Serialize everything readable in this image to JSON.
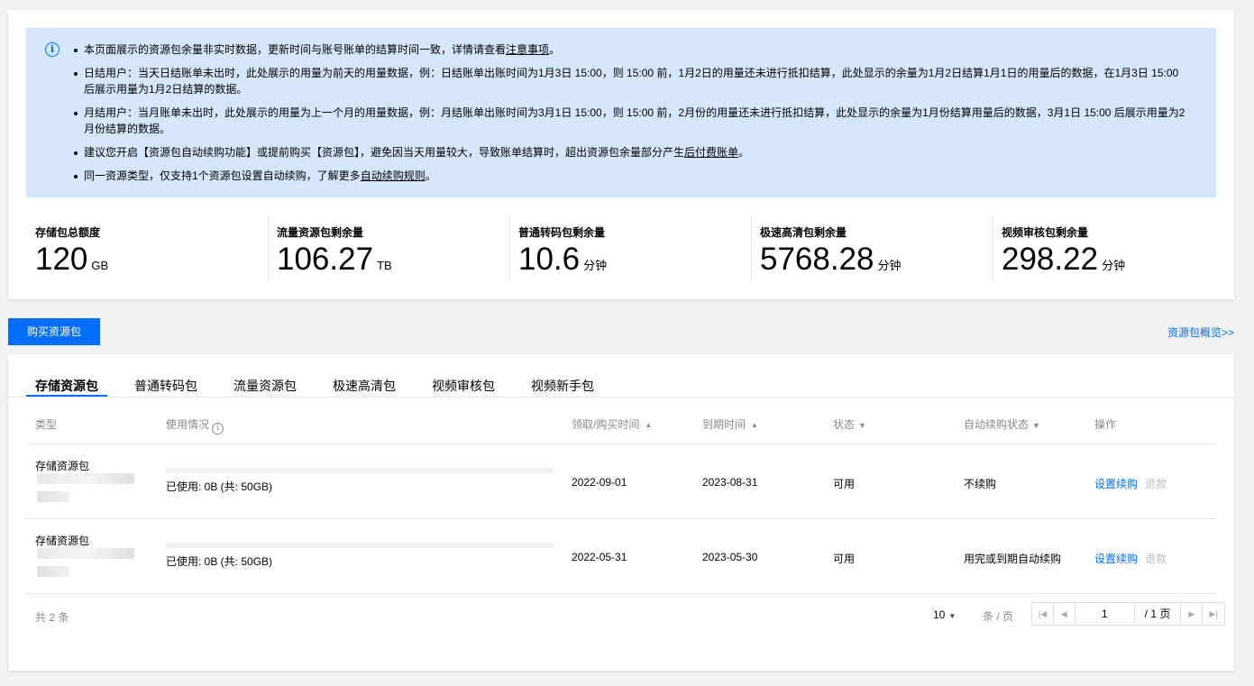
{
  "notice": {
    "items": [
      {
        "text": "本页面展示的资源包余量非实时数据，更新时间与账号账单的结算时间一致，详情请查看",
        "link": "注意事项",
        "suffix": "。"
      },
      {
        "text": "日结用户：当天日结账单未出时，此处展示的用量为前天的用量数据，例：日结账单出账时间为1月3日 15:00，则 15:00 前，1月2日的用量还未进行抵扣结算，此处显示的余量为1月2日结算1月1日的用量后的数据，在1月3日 15:00 后展示用量为1月2日结算的数据。",
        "link": "",
        "suffix": ""
      },
      {
        "text": "月结用户：当月账单未出时，此处展示的用量为上一个月的用量数据，例：月结账单出账时间为3月1日 15:00，则 15:00 前，2月份的用量还未进行抵扣结算，此处显示的余量为1月份结算用量后的数据，3月1日 15:00 后展示用量为2月份结算的数据。",
        "link": "",
        "suffix": ""
      },
      {
        "text": "建议您开启【资源包自动续购功能】或提前购买【资源包】，避免因当天用量较大，导致账单结算时，超出资源包余量部分产生",
        "link": "后付费账单",
        "suffix": "。"
      },
      {
        "text": "同一资源类型，仅支持1个资源包设置自动续购，了解更多",
        "link": "自动续购规则",
        "suffix": "。"
      }
    ]
  },
  "stats": [
    {
      "label": "存储包总额度",
      "value": "120",
      "unit": "GB"
    },
    {
      "label": "流量资源包剩余量",
      "value": "106.27",
      "unit": "TB"
    },
    {
      "label": "普通转码包剩余量",
      "value": "10.6",
      "unit": "分钟"
    },
    {
      "label": "极速高清包剩余量",
      "value": "5768.28",
      "unit": "分钟"
    },
    {
      "label": "视频审核包剩余量",
      "value": "298.22",
      "unit": "分钟"
    }
  ],
  "actions": {
    "buy_label": "购买资源包",
    "overview_label": "资源包概览>>"
  },
  "tabs": [
    "存储资源包",
    "普通转码包",
    "流量资源包",
    "极速高清包",
    "视频审核包",
    "视频新手包"
  ],
  "table": {
    "headers": {
      "type": "类型",
      "usage": "使用情况",
      "acquired": "领取/购买时间",
      "expire": "到期时间",
      "status": "状态",
      "renew": "自动续购状态",
      "ops": "操作"
    },
    "rows": [
      {
        "type": "存储资源包",
        "usage_text": "已使用: 0B (共: 50GB)",
        "usage_fraction": 0,
        "acquired": "2022-09-01",
        "expire": "2023-08-31",
        "status": "可用",
        "renew": "不续购",
        "op_primary": "设置续购",
        "op_secondary": "退款"
      },
      {
        "type": "存储资源包",
        "usage_text": "已使用: 0B (共: 50GB)",
        "usage_fraction": 0,
        "acquired": "2022-05-31",
        "expire": "2023-05-30",
        "status": "可用",
        "renew": "用完或到期自动续购",
        "op_primary": "设置续购",
        "op_secondary": "退款"
      }
    ]
  },
  "pagination": {
    "total_text": "共 2 条",
    "page_size": "10",
    "per_page_text": "条 / 页",
    "current_page": "1",
    "total_pages_text": "/ 1 页"
  }
}
